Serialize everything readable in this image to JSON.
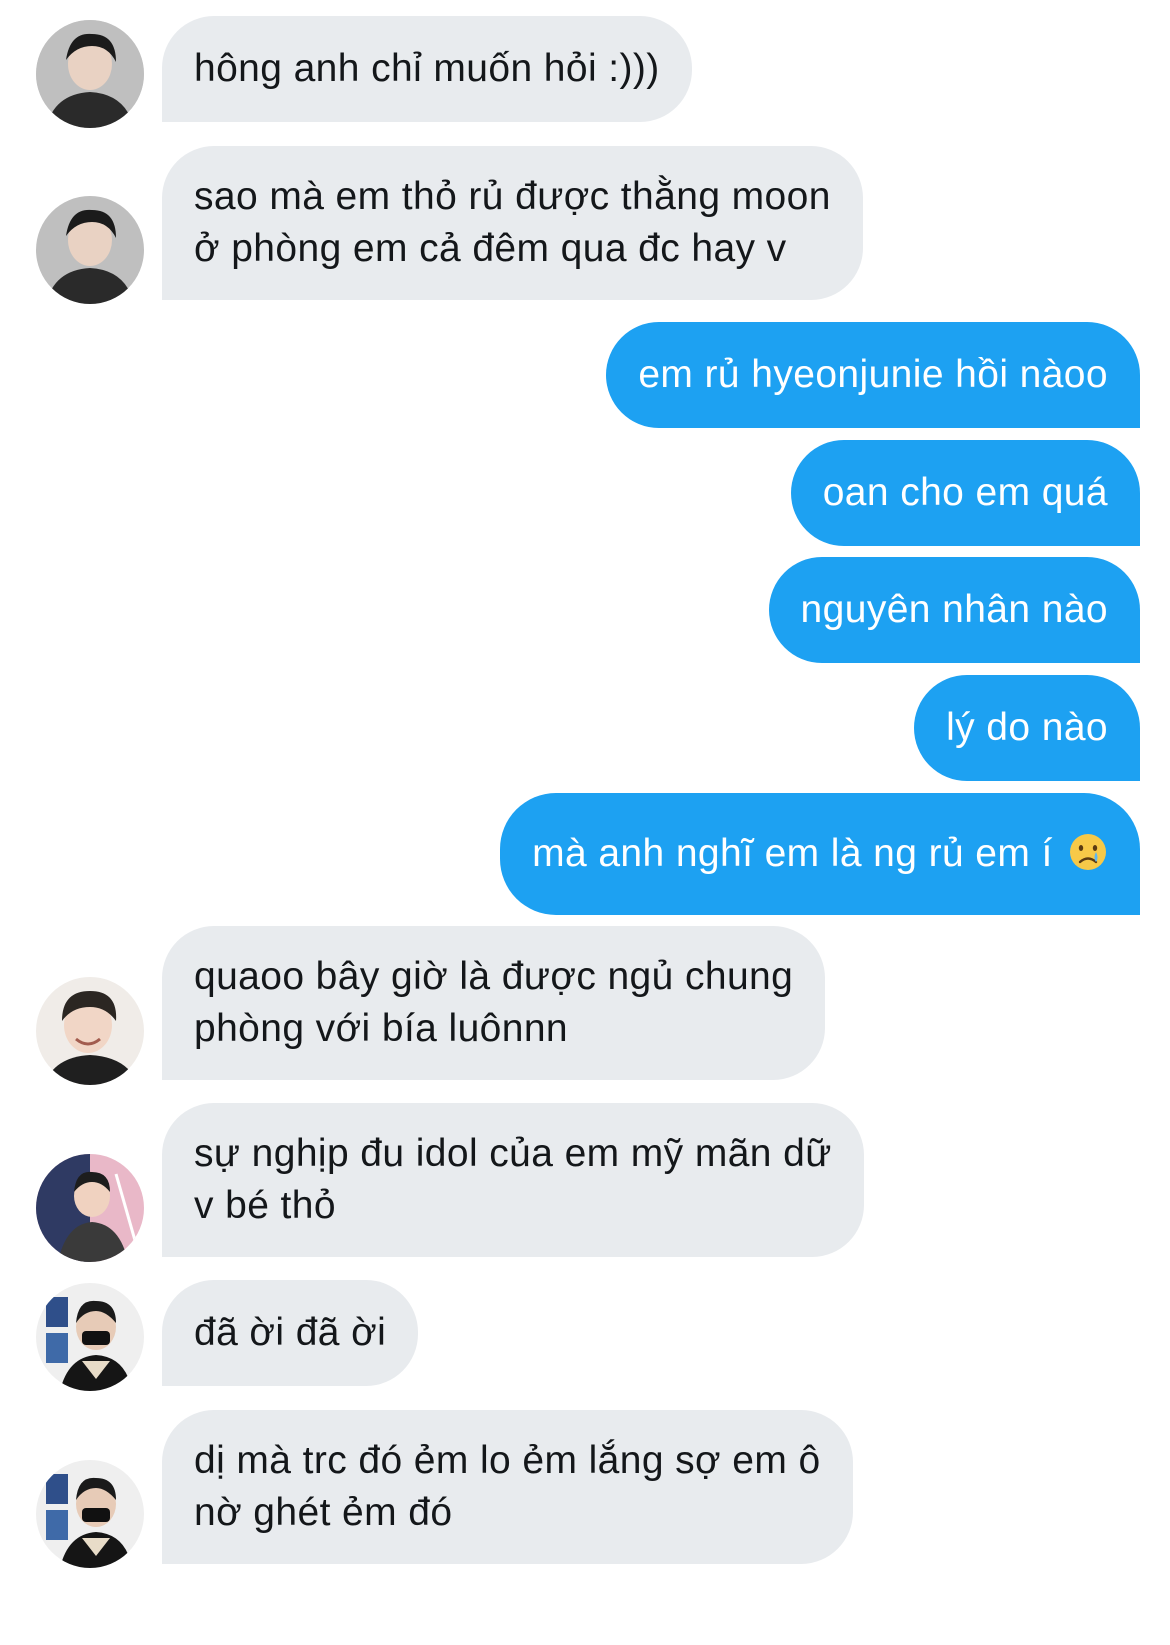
{
  "messages": [
    {
      "sender": "incoming",
      "avatar": "avatar-a",
      "lines": [
        "hông anh chỉ muốn hỏi :)))"
      ]
    },
    {
      "sender": "incoming",
      "avatar": "avatar-a",
      "lines": [
        "sao mà em thỏ rủ được thằng moon",
        "ở phòng em cả đêm qua đc hay v"
      ]
    },
    {
      "sender": "outgoing",
      "lines": [
        "em rủ hyeonjunie hồi nàoo"
      ]
    },
    {
      "sender": "outgoing",
      "lines": [
        "oan cho em quá"
      ]
    },
    {
      "sender": "outgoing",
      "lines": [
        "nguyên nhân nào"
      ]
    },
    {
      "sender": "outgoing",
      "lines": [
        "lý do nào"
      ]
    },
    {
      "sender": "outgoing",
      "lines": [
        "mà anh nghĩ em là ng rủ em í"
      ],
      "emoji": "crying-face-emoji"
    },
    {
      "sender": "incoming",
      "avatar": "avatar-b",
      "lines": [
        "quaoo bây giờ là được ngủ chung",
        "phòng với bía luônnn"
      ]
    },
    {
      "sender": "incoming",
      "avatar": "avatar-c",
      "lines": [
        "sự nghịp đu idol của em mỹ mãn dữ",
        "v bé thỏ"
      ]
    },
    {
      "sender": "incoming",
      "avatar": "avatar-d",
      "lines": [
        "đã ời đã ời"
      ]
    },
    {
      "sender": "incoming",
      "avatar": "avatar-d",
      "lines": [
        "dị mà trc đó ẻm lo ẻm lắng sợ em ô",
        "nờ ghét ẻm đó"
      ]
    }
  ],
  "colors": {
    "incoming_bubble": "#e8ebee",
    "outgoing_bubble": "#1da1f2",
    "incoming_text": "#14171a",
    "outgoing_text": "#ffffff"
  }
}
